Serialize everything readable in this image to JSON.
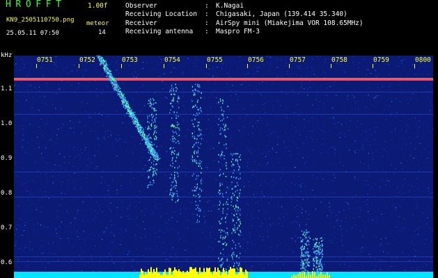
{
  "header": {
    "app_title": "HROFFT",
    "version": "1.00f",
    "filename": "KN9_2505110750.png",
    "datetime": "25.05.11 07:50",
    "meteor_label": "meteor",
    "meteor_count": "14"
  },
  "info": [
    {
      "key": "Observer",
      "sep": ":",
      "value": "K.Nagai"
    },
    {
      "key": "Receiving Location",
      "sep": ":",
      "value": "Chigasaki, Japan (139.414 35.340)"
    },
    {
      "key": "Receiver",
      "sep": ":",
      "value": "AirSpy mini (Miakejima VOR 108.65MHz)"
    },
    {
      "key": "Receiving antenna",
      "sep": ":",
      "value": "Maspro FM-3"
    }
  ],
  "spectrogram": {
    "y_unit": "kHz",
    "y_ticks": [
      "1.1",
      "1.0",
      "0.9",
      "0.8",
      "0.7",
      "0.6"
    ],
    "x_ticks": [
      "0751",
      "0752",
      "0753",
      "0754",
      "0755",
      "0756",
      "0757",
      "0758",
      "0759",
      "0800"
    ],
    "colors": {
      "background": "#0a1a75",
      "carrier": "#ff4a6a",
      "trace": "#5cffb0",
      "baseline": "#00e5ff",
      "burst": "#ffff00"
    }
  }
}
